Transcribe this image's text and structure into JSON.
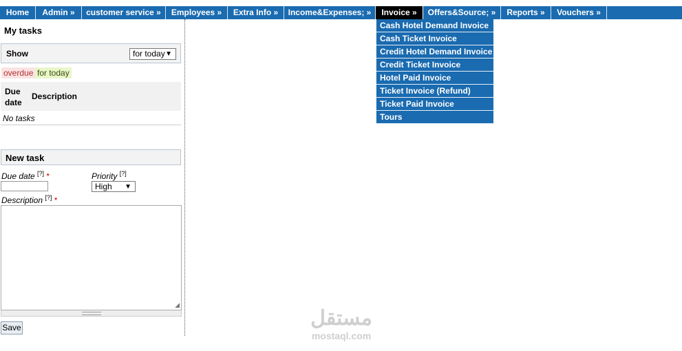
{
  "nav": {
    "items": [
      {
        "label": "Home"
      },
      {
        "label": "Admin »"
      },
      {
        "label": "customer service »"
      },
      {
        "label": "Employees »"
      },
      {
        "label": "Extra Info »"
      },
      {
        "label": "Income&Expenses; »"
      },
      {
        "label": "Invoice »"
      },
      {
        "label": "Offers&Source; »"
      },
      {
        "label": "Reports »"
      },
      {
        "label": "Vouchers »"
      }
    ],
    "active_index": 6
  },
  "invoice_menu": {
    "items": [
      "Cash Hotel Demand Invoice",
      "Cash Ticket Invoice",
      "Credit Hotel Demand Invoice",
      "Credit Ticket Invoice",
      "Hotel Paid Invoice",
      "Ticket Invoice (Refund)",
      "Ticket Paid Invoice",
      "Tours"
    ]
  },
  "tasks": {
    "title": "My tasks",
    "show_label": "Show",
    "show_value": "for today",
    "legend_overdue": "overdue",
    "legend_today": "for today",
    "col_due": "Due date",
    "col_description": "Description",
    "empty_text": "No tasks"
  },
  "new_task": {
    "title": "New task",
    "due_label": "Due date",
    "priority_label": "Priority",
    "priority_value": "High",
    "description_label": "Description",
    "help_mark": "[?]",
    "required_mark": "*",
    "save_label": "Save"
  },
  "watermark": {
    "arabic": "مستقل",
    "latin": "mostaql.com"
  },
  "colors": {
    "nav_bg": "#1a6bb0",
    "nav_active": "#000000",
    "overdue_bg": "#fbe3e3",
    "today_bg": "#e8f6c9"
  }
}
